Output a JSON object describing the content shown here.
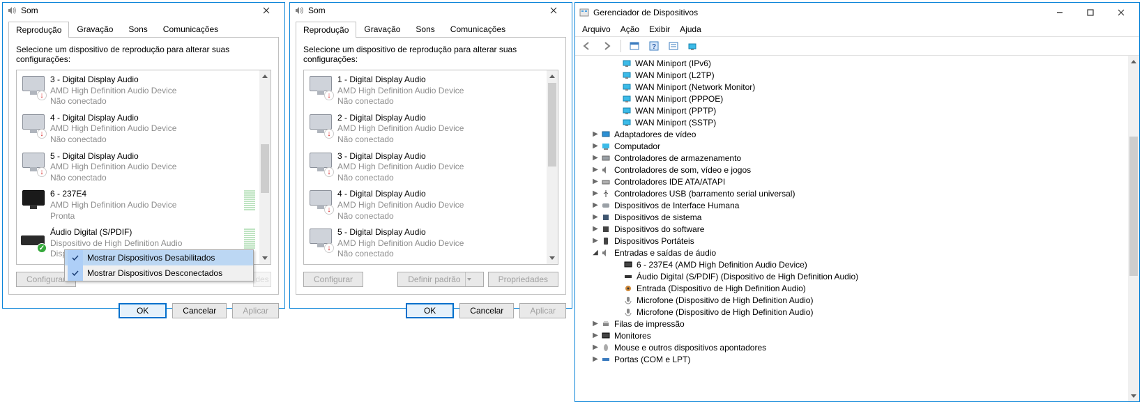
{
  "sound": {
    "title": "Som",
    "tabs": [
      "Reprodução",
      "Gravação",
      "Sons",
      "Comunicações"
    ],
    "instruction": "Selecione um dispositivo de reprodução para alterar suas configurações:",
    "btn_configure": "Configurar",
    "btn_default": "Definir padrão",
    "btn_props": "Propriedades",
    "btn_ok": "OK",
    "btn_cancel": "Cancelar",
    "btn_apply": "Aplicar"
  },
  "win1_devices": [
    {
      "name": "3 - Digital Display Audio",
      "desc": "AMD High Definition Audio Device",
      "status": "Não conectado",
      "type": "monitor",
      "badge": "down"
    },
    {
      "name": "4 - Digital Display Audio",
      "desc": "AMD High Definition Audio Device",
      "status": "Não conectado",
      "type": "monitor",
      "badge": "down"
    },
    {
      "name": "5 - Digital Display Audio",
      "desc": "AMD High Definition Audio Device",
      "status": "Não conectado",
      "type": "monitor",
      "badge": "down"
    },
    {
      "name": "6 - 237E4",
      "desc": "AMD High Definition Audio Device",
      "status": "Pronta",
      "type": "monitor-dark",
      "meter": true
    },
    {
      "name": "Áudio Digital (S/PDIF)",
      "desc": "Dispositivo de High Definition Audio",
      "status": "Dispositivo Padrão",
      "type": "spdif",
      "badge": "ok",
      "meter": true
    }
  ],
  "win2_devices": [
    {
      "name": "1 - Digital Display Audio",
      "desc": "AMD High Definition Audio Device",
      "status": "Não conectado",
      "type": "monitor",
      "badge": "down"
    },
    {
      "name": "2 - Digital Display Audio",
      "desc": "AMD High Definition Audio Device",
      "status": "Não conectado",
      "type": "monitor",
      "badge": "down"
    },
    {
      "name": "3 - Digital Display Audio",
      "desc": "AMD High Definition Audio Device",
      "status": "Não conectado",
      "type": "monitor",
      "badge": "down"
    },
    {
      "name": "4 - Digital Display Audio",
      "desc": "AMD High Definition Audio Device",
      "status": "Não conectado",
      "type": "monitor",
      "badge": "down"
    },
    {
      "name": "5 - Digital Display Audio",
      "desc": "AMD High Definition Audio Device",
      "status": "Não conectado",
      "type": "monitor",
      "badge": "down"
    }
  ],
  "context_menu": [
    "Mostrar Dispositivos Desabilitados",
    "Mostrar Dispositivos Desconectados"
  ],
  "devmgr": {
    "title": "Gerenciador de Dispositivos",
    "menus": [
      "Arquivo",
      "Ação",
      "Exibir",
      "Ajuda"
    ],
    "nodes": [
      {
        "l": 0,
        "label": "WAN Miniport (IPv6)",
        "icon": "net"
      },
      {
        "l": 0,
        "label": "WAN Miniport (L2TP)",
        "icon": "net"
      },
      {
        "l": 0,
        "label": "WAN Miniport (Network Monitor)",
        "icon": "net"
      },
      {
        "l": 0,
        "label": "WAN Miniport (PPPOE)",
        "icon": "net"
      },
      {
        "l": 0,
        "label": "WAN Miniport (PPTP)",
        "icon": "net"
      },
      {
        "l": 0,
        "label": "WAN Miniport (SSTP)",
        "icon": "net"
      },
      {
        "l": 1,
        "caret": "closed",
        "label": "Adaptadores de vídeo",
        "icon": "display"
      },
      {
        "l": 1,
        "caret": "closed",
        "label": "Computador",
        "icon": "computer"
      },
      {
        "l": 1,
        "caret": "closed",
        "label": "Controladores de armazenamento",
        "icon": "storage"
      },
      {
        "l": 1,
        "caret": "closed",
        "label": "Controladores de som, vídeo e jogos",
        "icon": "sound"
      },
      {
        "l": 1,
        "caret": "closed",
        "label": "Controladores IDE ATA/ATAPI",
        "icon": "ide"
      },
      {
        "l": 1,
        "caret": "closed",
        "label": "Controladores USB (barramento serial universal)",
        "icon": "usb"
      },
      {
        "l": 1,
        "caret": "closed",
        "label": "Dispositivos de Interface Humana",
        "icon": "hid"
      },
      {
        "l": 1,
        "caret": "closed",
        "label": "Dispositivos de sistema",
        "icon": "system"
      },
      {
        "l": 1,
        "caret": "closed",
        "label": "Dispositivos do software",
        "icon": "software"
      },
      {
        "l": 1,
        "caret": "closed",
        "label": "Dispositivos Portáteis",
        "icon": "portable"
      },
      {
        "l": 1,
        "caret": "open",
        "label": "Entradas e saídas de áudio",
        "icon": "sound"
      },
      {
        "l": 2,
        "label": "6 - 237E4 (AMD High Definition Audio Device)",
        "icon": "monitor"
      },
      {
        "l": 2,
        "label": "Áudio Digital (S/PDIF) (Dispositivo de High Definition Audio)",
        "icon": "spdif"
      },
      {
        "l": 2,
        "label": "Entrada (Dispositivo de High Definition Audio)",
        "icon": "jack"
      },
      {
        "l": 2,
        "label": "Microfone (Dispositivo de High Definition Audio)",
        "icon": "mic"
      },
      {
        "l": 2,
        "label": "Microfone (Dispositivo de High Definition Audio)",
        "icon": "mic"
      },
      {
        "l": 1,
        "caret": "closed",
        "label": "Filas de impressão",
        "icon": "printer"
      },
      {
        "l": 1,
        "caret": "closed",
        "label": "Monitores",
        "icon": "monitor"
      },
      {
        "l": 1,
        "caret": "closed",
        "label": "Mouse e outros dispositivos apontadores",
        "icon": "mouse"
      },
      {
        "l": 1,
        "caret": "closed",
        "label": "Portas (COM e LPT)",
        "icon": "port"
      }
    ]
  }
}
